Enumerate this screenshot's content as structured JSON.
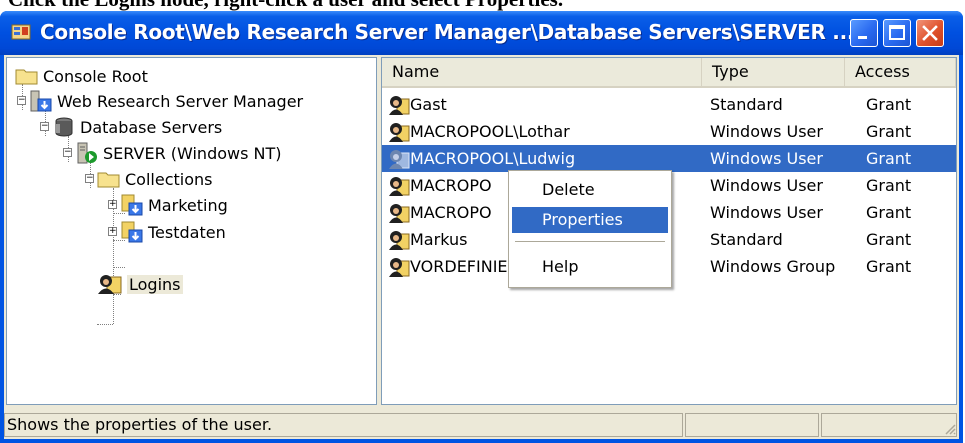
{
  "instruction": "Click the Logins node, right-click a user and select Properties.",
  "window": {
    "title": "Console Root\\Web Research Server Manager\\Database Servers\\SERVER ...",
    "colors": {
      "titlebar": "#0054e3",
      "selection": "#316ac5",
      "face": "#ece9d8"
    }
  },
  "tree": {
    "console_root": "Console Root",
    "manager": "Web Research Server Manager",
    "db_servers": "Database Servers",
    "server": "SERVER (Windows NT)",
    "collections": "Collections",
    "marketing": "Marketing",
    "testdaten": "Testdaten",
    "logins": "Logins"
  },
  "list": {
    "headers": {
      "name": "Name",
      "type": "Type",
      "access": "Access"
    },
    "rows": [
      {
        "name": "Gast",
        "type": "Standard",
        "access": "Grant"
      },
      {
        "name": "MACROPOOL\\Lothar",
        "type": "Windows User",
        "access": "Grant"
      },
      {
        "name": "MACROPOOL\\Ludwig",
        "type": "Windows User",
        "access": "Grant"
      },
      {
        "name": "MACROPO",
        "type": "Windows User",
        "access": "Grant"
      },
      {
        "name": "MACROPO",
        "type": "Windows User",
        "access": "Grant"
      },
      {
        "name": "Markus",
        "type": "Standard",
        "access": "Grant"
      },
      {
        "name": "VORDEFINIERT\\Administratoren",
        "type": "Windows Group",
        "access": "Grant"
      }
    ]
  },
  "context_menu": {
    "delete": "Delete",
    "properties": "Properties",
    "help": "Help"
  },
  "status_bar": {
    "text": "Shows the properties of the user."
  },
  "icons": [
    "app-icon",
    "folder-icon",
    "server-manager-icon",
    "database-icon",
    "server-icon",
    "collection-icon",
    "logins-icon",
    "user-icon",
    "minimize-icon",
    "maximize-icon",
    "close-icon"
  ]
}
